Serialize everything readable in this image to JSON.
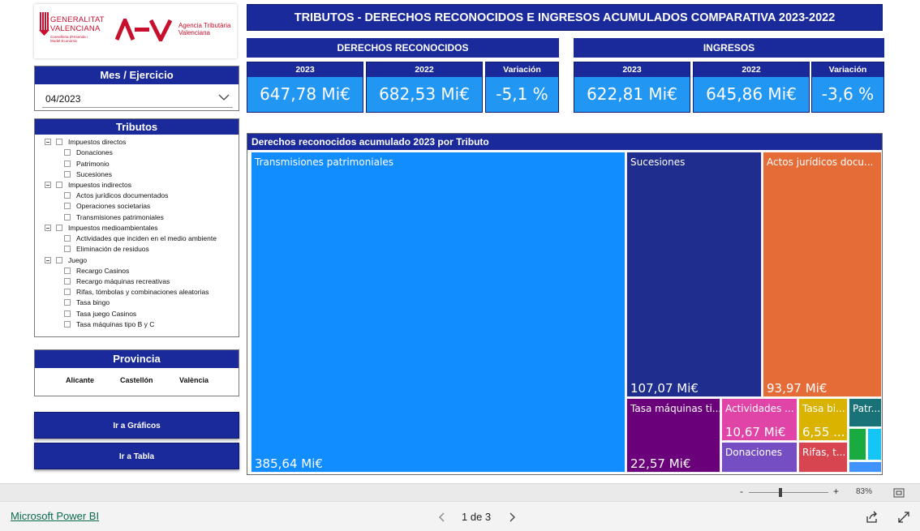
{
  "logo": {
    "generalitat_line1": "GENERALITAT",
    "generalitat_line2": "VALENCIANA",
    "conselleria": "Conselleria d'Hisenda i Model Econòmic",
    "agency_line1": "Agencia Tributària",
    "agency_line2": "Valenciana",
    "agency_mark": "ATV"
  },
  "title": "TRIBUTOS - DERECHOS RECONOCIDOS E INGRESOS ACUMULADOS COMPARATIVA 2023-2022",
  "filters": {
    "mes_ejercicio": {
      "header": "Mes / Ejercicio",
      "selected": "04/2023",
      "icon": "chevron-down-icon"
    },
    "tributos": {
      "header": "Tributos",
      "groups": [
        {
          "label": "Impuestos directos",
          "items": [
            "Donaciones",
            "Patrimonio",
            "Sucesiones"
          ]
        },
        {
          "label": "Impuestos indirectos",
          "items": [
            "Actos jurídicos documentados",
            "Operaciones societarias",
            "Transmisiones patrimoniales"
          ]
        },
        {
          "label": "Impuestos medioambientales",
          "items": [
            "Actividades que inciden en el medio ambiente",
            "Eliminación de residuos"
          ]
        },
        {
          "label": "Juego",
          "items": [
            "Recargo Casinos",
            "Recargo máquinas recreativas",
            "Rifas, tómbolas y combinaciones aleatorias",
            "Tasa bingo",
            "Tasa juego Casinos",
            "Tasa máquinas tipo B y C"
          ]
        }
      ]
    },
    "provincia": {
      "header": "Provincia",
      "options": [
        "Alicante",
        "Castellón",
        "València"
      ]
    }
  },
  "buttons": {
    "graficos": "Ir a Gráficos",
    "tabla": "Ir a Tabla"
  },
  "derechos": {
    "header": "DERECHOS RECONOCIDOS",
    "kpis": [
      {
        "label": "2023",
        "value": "647,78 Mi€"
      },
      {
        "label": "2022",
        "value": "682,53 Mi€"
      },
      {
        "label": "Variación",
        "value": "-5,1 %"
      }
    ]
  },
  "ingresos": {
    "header": "INGRESOS",
    "kpis": [
      {
        "label": "2023",
        "value": "622,81 Mi€"
      },
      {
        "label": "2022",
        "value": "645,86 Mi€"
      },
      {
        "label": "Variación",
        "value": "-3,6 %"
      }
    ]
  },
  "treemap": {
    "header": "Derechos reconocidos acumulado 2023 por Tributo",
    "cells": [
      {
        "label": "Transmisiones patrimoniales",
        "value": "385,64 Mi€",
        "color": "#118dff"
      },
      {
        "label": "Sucesiones",
        "value": "107,07 Mi€",
        "color": "#1f2d8f"
      },
      {
        "label": "Actos jurídicos docu...",
        "value": "93,97 Mi€",
        "color": "#e66c37"
      },
      {
        "label": "Tasa máquinas ti...",
        "value": "22,57 Mi€",
        "color": "#6b007b"
      },
      {
        "label": "Actividades ...",
        "value": "10,67 Mi€",
        "color": "#e044a7"
      },
      {
        "label": "Tasa bi...",
        "value": "6,55 ...",
        "color": "#d9b300"
      },
      {
        "label": "Patr...",
        "value": "",
        "color": "#197278"
      },
      {
        "label": "Donaciones",
        "value": "",
        "color": "#744ec2"
      },
      {
        "label": "Rifas, t...",
        "value": "",
        "color": "#d64550"
      },
      {
        "label": "",
        "value": "",
        "color": "#1aab40"
      },
      {
        "label": "",
        "value": "",
        "color": "#15c6f4"
      },
      {
        "label": "",
        "value": "",
        "color": "#4092ff"
      }
    ]
  },
  "zoom": {
    "minus": "-",
    "plus": "+",
    "level": "83%"
  },
  "footer": {
    "brand": "Microsoft Power BI",
    "page_indicator": "1 de 3"
  }
}
